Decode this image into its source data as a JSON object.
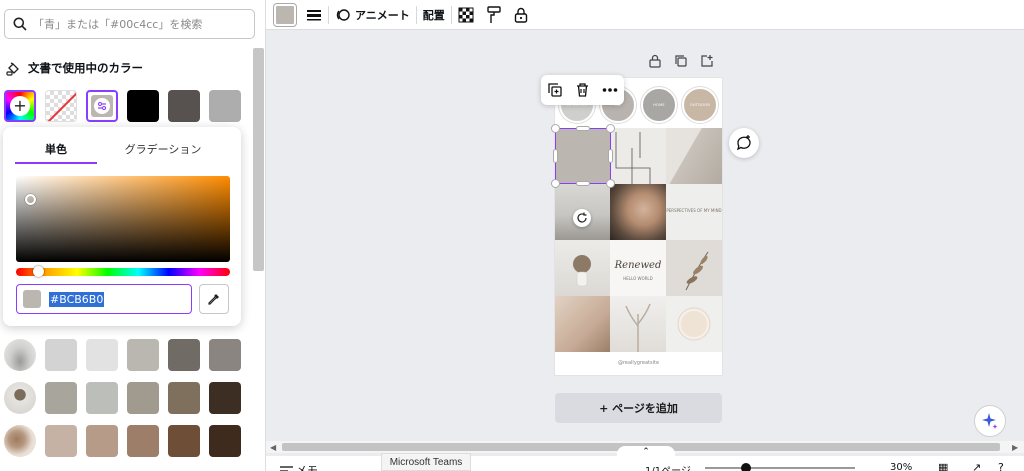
{
  "search": {
    "placeholder": "「青」または「#00c4cc」を検索"
  },
  "doc_colors": {
    "title": "文書で使用中のカラー",
    "swatches": [
      "#BCB6B0",
      "#000000",
      "#575250",
      "#ADADAD"
    ]
  },
  "color_picker": {
    "tabs": [
      "単色",
      "グラデーション"
    ],
    "hex": "#BCB6B0",
    "preview": "#BCB6B0",
    "hue_base": "#FF8C00"
  },
  "palette": [
    [
      "photo-wave",
      "#D3D3D3",
      "#E1E2E1",
      "#BAB7B0",
      "#706B65",
      "#8A8580"
    ],
    [
      "photo-vase",
      "#A8A59D",
      "#BCBEB9",
      "#A09A8F",
      "#7E705D",
      "#3C2E23"
    ],
    [
      "photo-hand",
      "#C6B2A4",
      "#B69C88",
      "#9D7F69",
      "#6E4E37",
      "#3F2B1E"
    ]
  ],
  "toolbar": {
    "selected_color": "#BCB6B0",
    "animate": "アニメート",
    "arrange": "配置"
  },
  "canvas": {
    "circles": [
      "LIFESTYLE",
      "ME",
      "HOME",
      "OUTDOOR"
    ],
    "grid_labels": {
      "perspectives": "PERSPECTIVES OF MY MIND",
      "brand": "Renewed",
      "brand_sub": "HELLO WORLD"
    },
    "footer": "@reallygreatsite"
  },
  "add_page": "+ ページを追加",
  "bottom": {
    "memo": "メモ",
    "teams": "Microsoft Teams",
    "pages": "1/1ページ",
    "zoom": "30%"
  },
  "colors": {
    "accent": "#8B3DFF"
  }
}
